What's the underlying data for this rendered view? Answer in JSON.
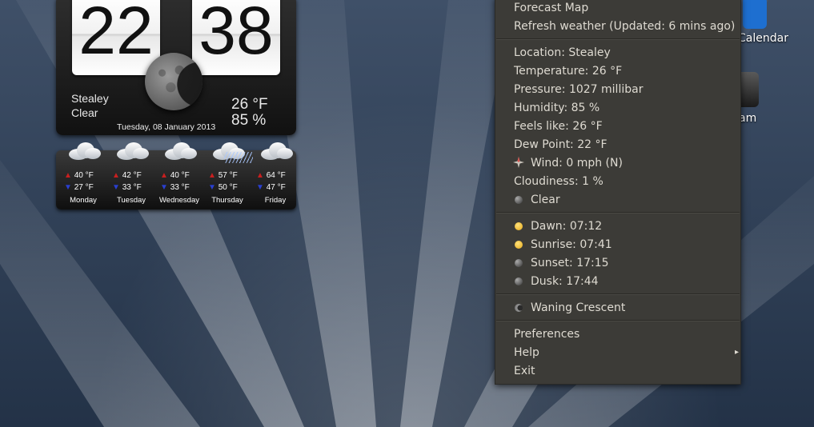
{
  "desktop": {
    "icons": [
      {
        "label": "Calendar",
        "name": "calendar-desktop-icon"
      },
      {
        "label": "am",
        "name": "search-desktop-icon"
      }
    ]
  },
  "clock": {
    "hours": "22",
    "minutes": "38",
    "location": "Stealey",
    "condition": "Clear",
    "temperature": "26 °F",
    "humidity": "85 %",
    "date": "Tuesday, 08 January 2013",
    "moon_icon": "moon-icon"
  },
  "forecast": [
    {
      "day": "Monday",
      "high": "40 °F",
      "low": "27 °F",
      "icon": "cloud-icon"
    },
    {
      "day": "Tuesday",
      "high": "42 °F",
      "low": "33 °F",
      "icon": "cloud-icon"
    },
    {
      "day": "Wednesday",
      "high": "40 °F",
      "low": "33 °F",
      "icon": "cloud-icon"
    },
    {
      "day": "Thursday",
      "high": "57 °F",
      "low": "50 °F",
      "icon": "rain-cloud-icon"
    },
    {
      "day": "Friday",
      "high": "64 °F",
      "low": "47 °F",
      "icon": "cloud-icon"
    }
  ],
  "menu": {
    "forecast_map": "Forecast Map",
    "refresh": "Refresh weather (Updated: 6 mins ago)",
    "location": "Location: Stealey",
    "temperature": "Temperature: 26 °F",
    "pressure": "Pressure: 1027 millibar",
    "humidity": "Humidity: 85 %",
    "feels_like": "Feels like: 26 °F",
    "dew_point": "Dew Point: 22 °F",
    "wind": "Wind: 0 mph (N)",
    "cloudiness": "Cloudiness: 1 %",
    "condition": "Clear",
    "dawn": "Dawn: 07:12",
    "sunrise": "Sunrise: 07:41",
    "sunset": "Sunset: 17:15",
    "dusk": "Dusk: 17:44",
    "moon_phase": "Waning Crescent",
    "preferences": "Preferences",
    "help": "Help",
    "exit": "Exit",
    "submenu_arrow": "▸"
  },
  "colors": {
    "menu_bg": "#3c3b37",
    "menu_text": "#dfdbd2",
    "high_arrow": "#c81f1f",
    "low_arrow": "#2a3fd0"
  }
}
